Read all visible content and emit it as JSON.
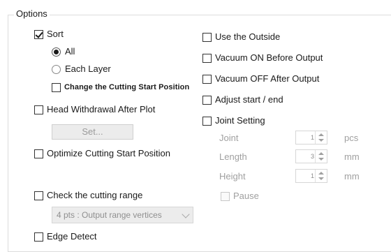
{
  "group": {
    "title": "Options"
  },
  "left": {
    "sort": {
      "label": "Sort",
      "checked": true
    },
    "sort_all": {
      "label": "All",
      "selected": true
    },
    "sort_each_layer": {
      "label": "Each Layer",
      "selected": false
    },
    "change_start": {
      "label": "Change the Cutting Start Position",
      "checked": false
    },
    "head_withdrawal": {
      "label": "Head Withdrawal After Plot",
      "checked": false
    },
    "set_button": {
      "label": "Set..."
    },
    "optimize_start": {
      "label": "Optimize Cutting Start Position",
      "checked": false
    },
    "check_range": {
      "label": "Check the cutting range",
      "checked": false
    },
    "range_combo": {
      "value": "4 pts : Output range vertices"
    },
    "edge_detect": {
      "label": "Edge Detect",
      "checked": false
    }
  },
  "right": {
    "use_outside": {
      "label": "Use the Outside",
      "checked": false
    },
    "vacuum_on": {
      "label": "Vacuum ON Before Output",
      "checked": false
    },
    "vacuum_off": {
      "label": "Vacuum OFF After Output",
      "checked": false
    },
    "adjust": {
      "label": "Adjust start / end",
      "checked": false
    },
    "joint_setting": {
      "label": "Joint Setting",
      "checked": false
    },
    "joint": {
      "label": "Joint",
      "value": "1",
      "unit": "pcs"
    },
    "length": {
      "label": "Length",
      "value": "3",
      "unit": "mm"
    },
    "height": {
      "label": "Height",
      "value": "1",
      "unit": "mm"
    },
    "pause": {
      "label": "Pause",
      "checked": false
    }
  }
}
